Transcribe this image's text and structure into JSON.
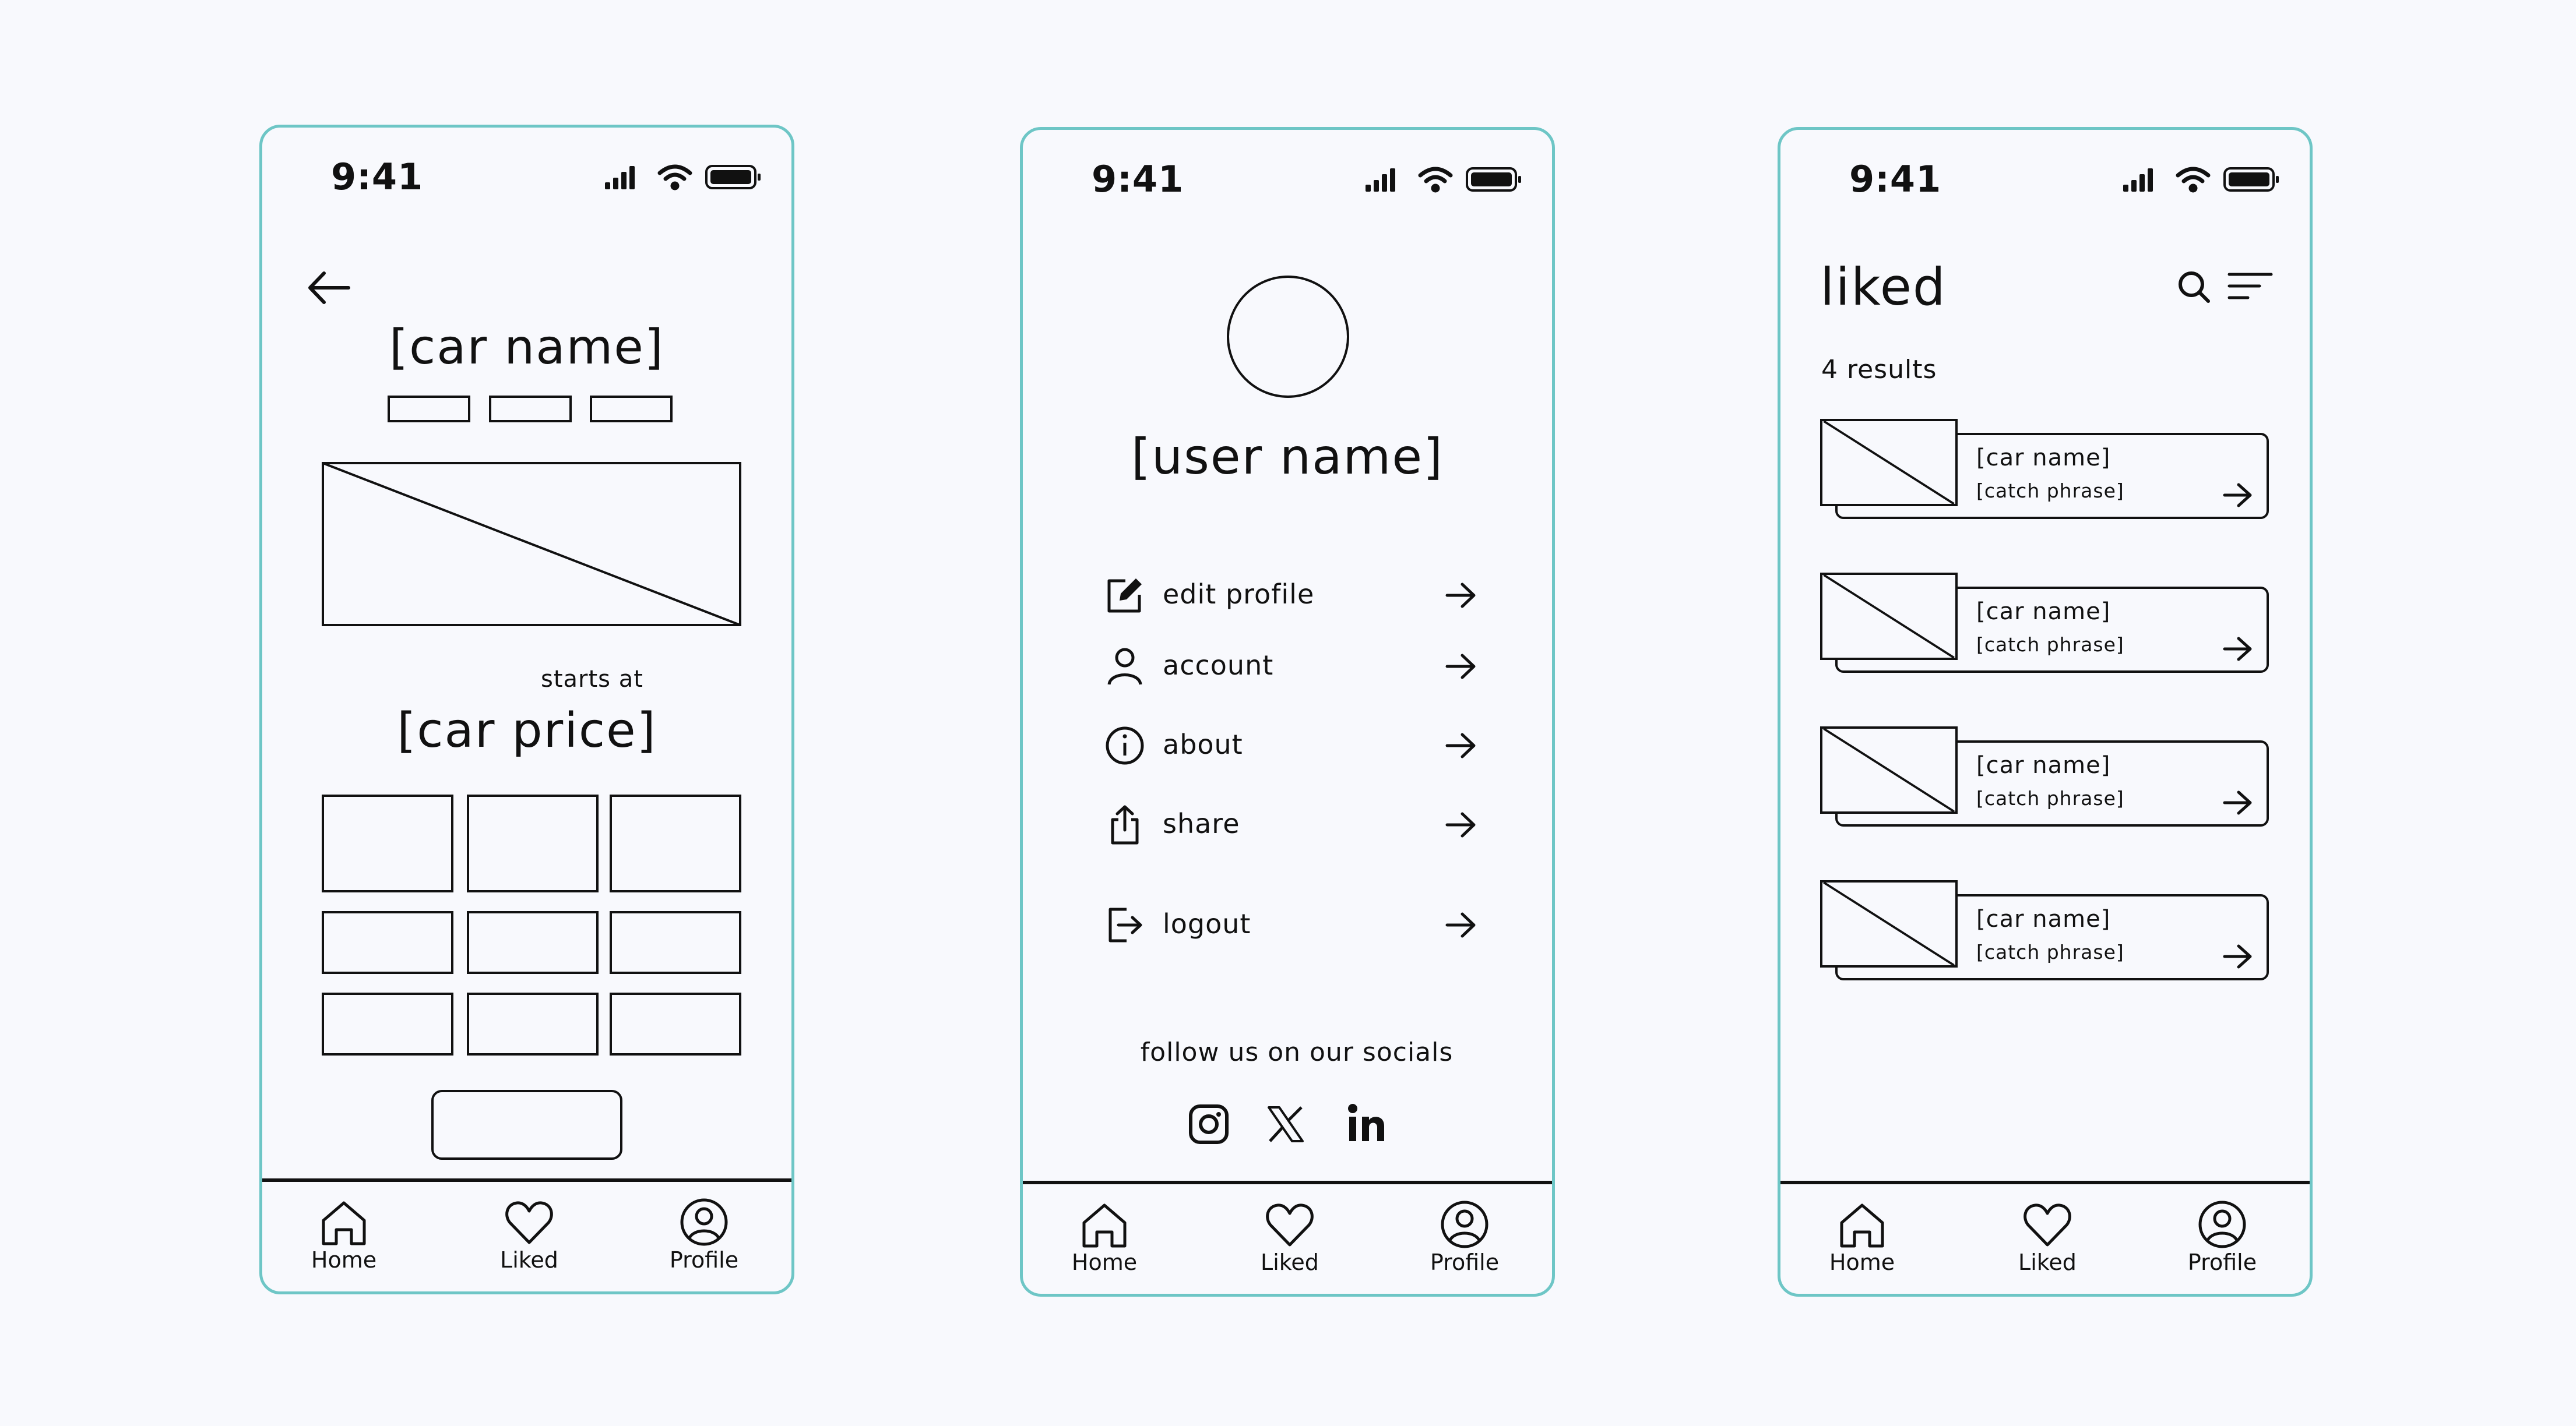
{
  "status": {
    "time": "9:41"
  },
  "nav": {
    "home": "Home",
    "liked": "Liked",
    "profile": "Profile"
  },
  "detail": {
    "car_name": "[car name]",
    "starts_at": "starts at",
    "car_price": "[car price]"
  },
  "profile": {
    "user_name": "[user name]",
    "menu": [
      {
        "label": "edit profile",
        "icon": "edit-icon"
      },
      {
        "label": "account",
        "icon": "user-icon"
      },
      {
        "label": "about",
        "icon": "info-icon"
      },
      {
        "label": "share",
        "icon": "share-icon"
      },
      {
        "label": "logout",
        "icon": "logout-icon"
      }
    ],
    "socials_label": "follow us on our socials",
    "socials": [
      "instagram-icon",
      "x-icon",
      "linkedin-icon"
    ]
  },
  "liked": {
    "title": "liked",
    "results": "4 results",
    "cards": [
      {
        "name": "[car name]",
        "phrase": "[catch phrase]"
      },
      {
        "name": "[car name]",
        "phrase": "[catch phrase]"
      },
      {
        "name": "[car name]",
        "phrase": "[catch phrase]"
      },
      {
        "name": "[car name]",
        "phrase": "[catch phrase]"
      }
    ]
  },
  "colors": {
    "frame": "#6ec6c6",
    "ink": "#111111",
    "background": "#f8f9fd"
  }
}
